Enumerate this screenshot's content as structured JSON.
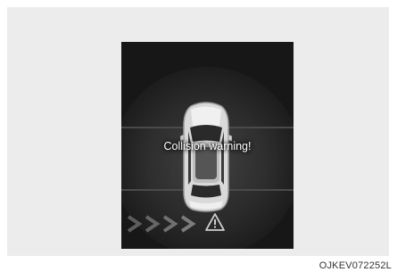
{
  "display": {
    "message": "Collision warning!",
    "icons": {
      "vehicle": "vehicle-top-view-icon",
      "approach": "approach-chevrons-icon",
      "warning": "warning-triangle-icon"
    },
    "colors": {
      "background": "#171717",
      "text": "#ffffff",
      "chevron": "#6a6a6a"
    }
  },
  "figure_code": "OJKEV072252L"
}
